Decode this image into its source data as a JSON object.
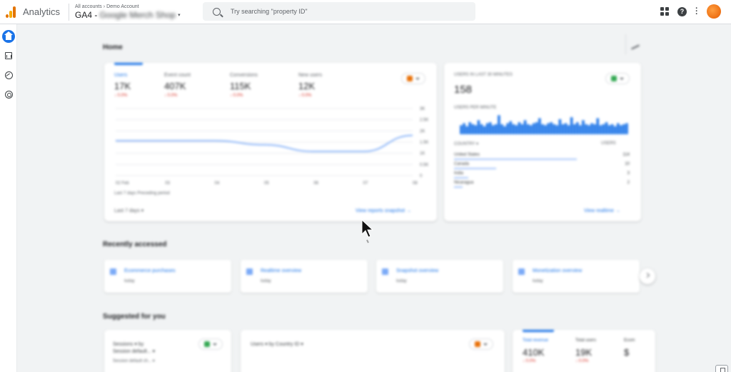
{
  "app": {
    "name": "Analytics",
    "breadcrumb": [
      "All accounts",
      "Demo Account"
    ],
    "property_prefix": "GA4 - ",
    "property_name": "Google Merch Shop",
    "colors": {
      "brand_orange": "#e37400",
      "brand_yellow": "#f9ab00",
      "accent_blue": "#1a73e8",
      "negative_red": "#d93025"
    }
  },
  "search": {
    "placeholder": "Try searching \"property ID\"",
    "icon": "search-icon"
  },
  "topbar_icons": [
    "apps-icon",
    "help-icon",
    "more-vert-icon",
    "account-avatar"
  ],
  "rail": {
    "items": [
      {
        "name": "home",
        "icon": "home-icon",
        "active": true
      },
      {
        "name": "reports",
        "icon": "reports-icon",
        "active": false
      },
      {
        "name": "explore",
        "icon": "explore-icon",
        "active": false
      },
      {
        "name": "advertising",
        "icon": "advertising-icon",
        "active": false
      }
    ]
  },
  "home": {
    "title": "Home",
    "metrics": [
      {
        "label": "Users",
        "value": "17K",
        "change": "↓ 0.0%"
      },
      {
        "label": "Event count",
        "value": "407K",
        "change": "↓ 0.0%"
      },
      {
        "label": "Conversions",
        "value": "115K",
        "change": "↓ 0.0%"
      },
      {
        "label": "New users",
        "value": "12K",
        "change": "↓ 0.0%"
      }
    ],
    "x_ticks": [
      "02 Feb",
      "03",
      "04",
      "05",
      "06",
      "07",
      "08"
    ],
    "y_ticks": [
      "3K",
      "2.5K",
      "2K",
      "1.5K",
      "1K",
      "0.5K",
      "0"
    ],
    "line_values": [
      0.52,
      0.52,
      0.52,
      0.46,
      0.36,
      0.36,
      0.6
    ],
    "legend": "Last 7 days   Preceding period",
    "footer_range": "Last 7 days ▾",
    "link": "View reports snapshot →"
  },
  "realtime": {
    "label": "USERS IN LAST 30 MINUTES",
    "value": "158",
    "sub_label": "USERS PER MINUTE",
    "bars": [
      0.45,
      0.55,
      0.4,
      0.6,
      0.5,
      0.45,
      0.7,
      0.5,
      0.4,
      0.55,
      0.6,
      0.45,
      0.5,
      0.95,
      0.5,
      0.4,
      0.55,
      0.65,
      0.5,
      0.45,
      0.6,
      0.5,
      0.7,
      0.5,
      0.45,
      0.55,
      0.6,
      0.8,
      0.5,
      0.45,
      0.55,
      0.6,
      0.5,
      0.45,
      0.75,
      0.5,
      0.55,
      0.45,
      0.85,
      0.5,
      0.6,
      0.45,
      0.7,
      0.5,
      0.45,
      0.55,
      0.5,
      0.8,
      0.45,
      0.5,
      0.6,
      0.45,
      0.5,
      0.4,
      0.55,
      0.45,
      0.5,
      0.55
    ],
    "axis_left": "COUNTRY ▾",
    "axis_right": "USERS",
    "rows": [
      {
        "name": "United States",
        "value": "114",
        "share": 0.7
      },
      {
        "name": "Canada",
        "value": "10",
        "share": 0.24
      },
      {
        "name": "India",
        "value": "3",
        "share": 0.08
      },
      {
        "name": "Nicaragua",
        "value": "2",
        "share": 0.05
      }
    ],
    "link": "View realtime →"
  },
  "recent": {
    "title": "Recently accessed",
    "items": [
      {
        "title": "Ecommerce purchases",
        "sub": "today"
      },
      {
        "title": "Realtime overview",
        "sub": "today"
      },
      {
        "title": "Snapshot overview",
        "sub": "today"
      },
      {
        "title": "Monetization overview",
        "sub": "today"
      }
    ]
  },
  "suggested": {
    "title": "Suggested for you",
    "card1": {
      "line1": "Sessions ▾ by",
      "line2": "Session default... ▾",
      "line3": "Session default ch... ▾"
    },
    "card2": {
      "line1": "Users ▾ by Country ID ▾"
    },
    "card3": {
      "metrics": [
        {
          "label": "Total revenue",
          "value": "410K",
          "change": "↓ 0.0%"
        },
        {
          "label": "Total users",
          "value": "19K",
          "change": "↓ 0.0%"
        },
        {
          "label": "Ecom",
          "value": "$",
          "change": ""
        }
      ]
    }
  }
}
